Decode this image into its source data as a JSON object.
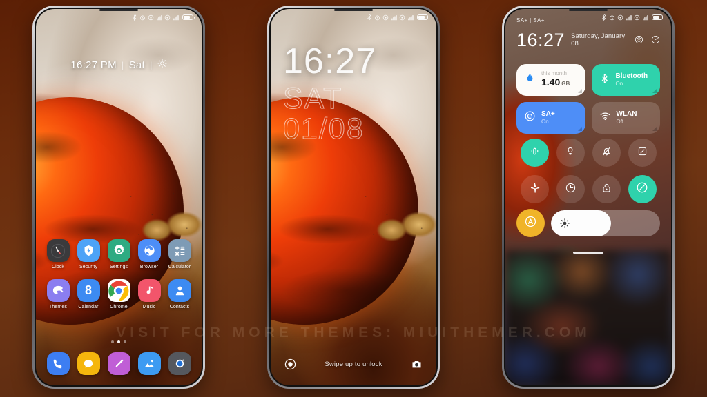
{
  "watermark": "VISIT FOR MORE THEMES: MIUITHEMER.COM",
  "background_color": "#6b2c0c",
  "phone_home": {
    "name": "home-screen",
    "statusbar": {
      "icons": [
        "bluetooth-icon",
        "alarm-icon",
        "signal-dot-icon",
        "signal-bars-icon",
        "signal-dot-icon-2",
        "signal-bars-icon-2",
        "battery-icon"
      ]
    },
    "clock_widget": {
      "time": "16:27 PM",
      "separator": "|",
      "day": "Sat",
      "weather_icon": "sun-icon"
    },
    "apps_row1": [
      {
        "label": "Clock",
        "icon": "clock-icon",
        "color": "#3a3a3c"
      },
      {
        "label": "Security",
        "icon": "shield-icon",
        "color": "#4da3f7"
      },
      {
        "label": "Settings",
        "icon": "gear-icon",
        "color": "#2eab82"
      },
      {
        "label": "Browser",
        "icon": "globe-icon",
        "color": "#4d8ef7"
      },
      {
        "label": "Calculator",
        "icon": "calculator-icon",
        "color": "#7e9bb5"
      }
    ],
    "apps_row2": [
      {
        "label": "Themes",
        "icon": "palette-icon",
        "color": "#8b7ef0"
      },
      {
        "label": "Calendar",
        "icon": "calendar-icon",
        "color": "#3d8bf2"
      },
      {
        "label": "Chrome",
        "icon": "chrome-icon",
        "color": "#ffffff"
      },
      {
        "label": "Music",
        "icon": "music-icon",
        "color": "#f2556b"
      },
      {
        "label": "Contacts",
        "icon": "person-icon",
        "color": "#3d8bf2"
      }
    ],
    "page_dots": {
      "count": 3,
      "active": 1
    },
    "dock": [
      {
        "label": "Phone",
        "icon": "phone-icon",
        "color": "#3d7ef2"
      },
      {
        "label": "Messages",
        "icon": "chat-icon",
        "color": "#f5b60d"
      },
      {
        "label": "Notes",
        "icon": "pencil-icon",
        "color": "#c05ed6"
      },
      {
        "label": "Gallery",
        "icon": "gallery-icon",
        "color": "#3d9bf2"
      },
      {
        "label": "Camera",
        "icon": "camera-icon",
        "color": "#55585e"
      }
    ]
  },
  "phone_lock": {
    "name": "lock-screen",
    "statusbar": {
      "icons": [
        "bluetooth-icon",
        "alarm-icon",
        "signal-dot-icon",
        "signal-bars-icon",
        "signal-dot-icon-2",
        "signal-bars-icon-2",
        "battery-icon"
      ]
    },
    "time": "16:27",
    "day": "SAT",
    "date": "01/08",
    "hint": "Swipe up to unlock",
    "left_shortcut": "flashlight-icon",
    "right_shortcut": "camera-icon"
  },
  "phone_control": {
    "name": "control-center",
    "carrier": "SA+ | SA+",
    "time": "16:27",
    "date": "Saturday, January 08",
    "header_icons": [
      "settings-ring-icon",
      "power-icon"
    ],
    "tiles": [
      {
        "name": "mobile-data-tile",
        "title": "1.40",
        "unit": "GB",
        "sub": "this month",
        "icon": "data-drop-icon",
        "state": "on",
        "style": "tile-data"
      },
      {
        "name": "bluetooth-tile",
        "title": "Bluetooth",
        "unit": "",
        "sub": "On",
        "icon": "bluetooth-icon",
        "state": "on",
        "style": "tile-bt"
      },
      {
        "name": "sa-plus-tile",
        "title": "SA+",
        "unit": "",
        "sub": "On",
        "icon": "e-network-icon",
        "state": "on",
        "style": "tile-sa"
      },
      {
        "name": "wlan-tile",
        "title": "WLAN",
        "unit": "",
        "sub": "Off",
        "icon": "wifi-icon",
        "state": "off",
        "style": "tile-wlan"
      }
    ],
    "toggles": [
      {
        "name": "flashlight-toggle",
        "icon": "flashlight-icon",
        "state": "on"
      },
      {
        "name": "dark-mode-toggle",
        "icon": "bulb-icon",
        "state": "off"
      },
      {
        "name": "silent-toggle",
        "icon": "bell-off-icon",
        "state": "off"
      },
      {
        "name": "screenshot-toggle",
        "icon": "screenshot-icon",
        "state": "off"
      },
      {
        "name": "airplane-toggle",
        "icon": "airplane-icon",
        "state": "off"
      },
      {
        "name": "timer-toggle",
        "icon": "clock-icon",
        "state": "off"
      },
      {
        "name": "lock-toggle",
        "icon": "lock-icon",
        "state": "off"
      },
      {
        "name": "dnd-toggle",
        "icon": "do-not-disturb-icon",
        "state": "on"
      }
    ],
    "brightness": {
      "auto_icon": "auto-brightness-icon",
      "slider_icon": "brightness-icon",
      "value_percent": 55
    },
    "accent_colors": {
      "active": "#2fd2ac",
      "blue": "#4e8ef7",
      "amber": "#f0b429"
    }
  }
}
